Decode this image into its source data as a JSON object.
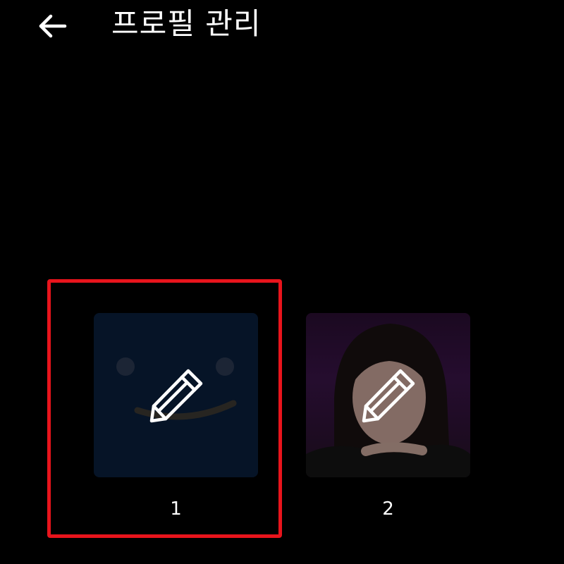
{
  "header": {
    "back_icon": "arrow-left-icon",
    "title": "프로필 관리"
  },
  "profiles": [
    {
      "name": "1",
      "avatar": "smiley-face",
      "edit_icon": "pencil-icon",
      "selected": true
    },
    {
      "name": "2",
      "avatar": "person-photo",
      "edit_icon": "pencil-icon",
      "selected": false
    }
  ],
  "colors": {
    "background": "#000000",
    "selection": "#e8141c",
    "text": "#ffffff",
    "avatar_1_bg": "#0a1f3d"
  }
}
